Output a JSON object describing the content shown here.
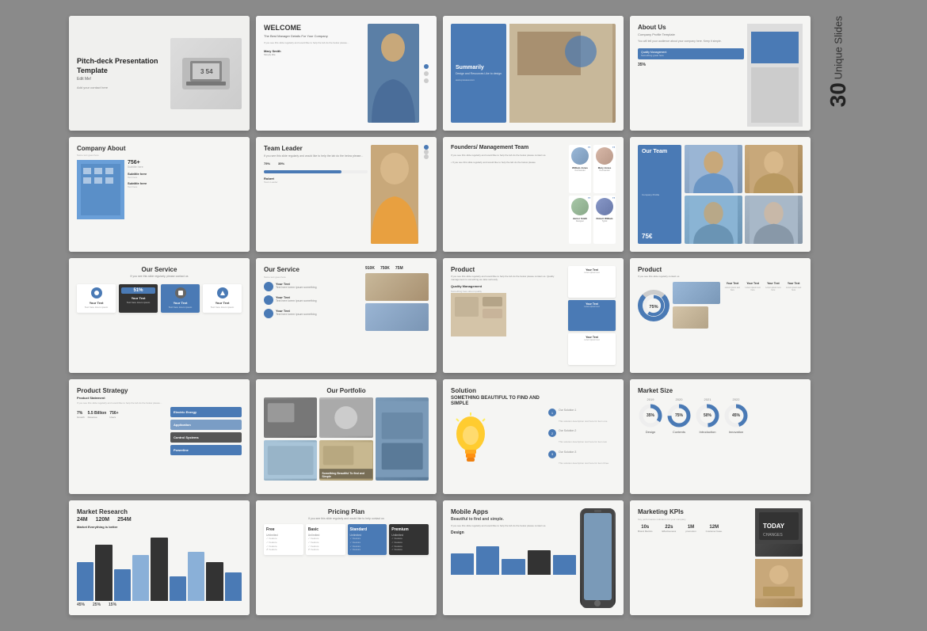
{
  "page": {
    "background_color": "#8a8a8a",
    "side_label": {
      "number": "30",
      "text": "Unique Slides"
    }
  },
  "slides": [
    {
      "id": 1,
      "title": "Pitch-deck Presentation Template",
      "subtitle": "Edit Me!",
      "meta": "Add your contact here"
    },
    {
      "id": 2,
      "title": "WELCOME",
      "subtitle": "The Best Manager Details For Your Company",
      "person_name": "Mary Smith",
      "person_role": "Simply title"
    },
    {
      "id": 3,
      "title": "Summarily",
      "subtitle": "Design and Resources Like to design",
      "url": "www.preview.com"
    },
    {
      "id": 4,
      "title": "About Us",
      "subtitle": "Company Profile Template",
      "section2_title": "Quality Management"
    },
    {
      "id": 5,
      "title": "Company About",
      "stat": "756+"
    },
    {
      "id": 6,
      "title": "Team Leader",
      "progress1": 75,
      "progress2": 35,
      "person_name": "Robert"
    },
    {
      "id": 7,
      "title": "Founders/ Management Team",
      "people": [
        {
          "name": "William Jones",
          "role": "Co-Founder"
        },
        {
          "name": "Mary Jones",
          "role": "Co-Founder"
        },
        {
          "name": "Junior Smith",
          "role": "Designer"
        },
        {
          "name": "Robert William",
          "role": "Typist"
        }
      ]
    },
    {
      "id": 8,
      "title": "Our Team",
      "stat": "75€"
    },
    {
      "id": 9,
      "title": "Our Service",
      "cards": [
        {
          "title": "Your Text",
          "percent": null
        },
        {
          "title": "Your Text",
          "percent": "51%"
        },
        {
          "title": "Your Text",
          "percent": null
        },
        {
          "title": "Your Text",
          "percent": null
        }
      ]
    },
    {
      "id": 10,
      "title": "Our Service",
      "items": [
        {
          "title": "Your Text"
        },
        {
          "title": "Your Text"
        },
        {
          "title": "Your Text"
        }
      ],
      "metrics": [
        "910K",
        "750K",
        "75M"
      ]
    },
    {
      "id": 11,
      "title": "Product",
      "quality": "Quality Management",
      "cards": [
        {
          "title": "Your Text"
        },
        {
          "title": "Your Text"
        },
        {
          "title": "Your Text"
        }
      ]
    },
    {
      "id": 12,
      "title": "Product",
      "cards": [
        {
          "title": "Your Text"
        },
        {
          "title": "Your Text"
        },
        {
          "title": "Your Text"
        },
        {
          "title": "Your Text"
        }
      ]
    },
    {
      "id": 13,
      "title": "Product Strategy",
      "statement": "Product Statement",
      "stats": [
        "7%",
        "5.5 Billion",
        "756+"
      ],
      "boxes": [
        {
          "title": "Electric Energy"
        },
        {
          "title": "Application"
        },
        {
          "title": "Control Systems"
        },
        {
          "title": "Powerline"
        }
      ]
    },
    {
      "id": 14,
      "title": "Our Portfolio",
      "label": "Something Beautiful To find and Simple"
    },
    {
      "id": 15,
      "title": "Solution",
      "big_text": "SOMETHING BEAUTIFUL TO FIND AND SIMPLE",
      "solutions": [
        "Our Solution 1",
        "Our Solution 2",
        "Our Solution 3"
      ]
    },
    {
      "id": 16,
      "title": "Market Size",
      "years": [
        "2019",
        "2020",
        "2021",
        "2022"
      ],
      "values": [
        "35%",
        "75%",
        "50%",
        "45%"
      ],
      "labels": [
        "Design",
        "Contents",
        "Introduction",
        "Innovation"
      ]
    },
    {
      "id": 17,
      "title": "Market Research",
      "subtitle": "Market Everything is better",
      "stats": [
        "24M",
        "120M",
        "254M"
      ],
      "percents": [
        "45%",
        "25%",
        "15%"
      ]
    },
    {
      "id": 18,
      "title": "Pricing Plan",
      "plans": [
        {
          "name": "Free",
          "price": "Unlimited"
        },
        {
          "name": "Basic",
          "price": "Unlimited"
        },
        {
          "name": "Standard",
          "price": "Unlimited"
        },
        {
          "name": "Premium",
          "price": "Unlimited"
        }
      ]
    },
    {
      "id": 19,
      "title": "Mobile Apps",
      "subtitle": "Beautiful to find and simple.",
      "section2": "Design"
    },
    {
      "id": 20,
      "title": "Marketing KPIs",
      "kpis": [
        {
          "value": "10s",
          "label": "Brand Metrics"
        },
        {
          "value": "22s",
          "label": "Effectiveness"
        },
        {
          "value": "1M",
          "label": "promotion"
        },
        {
          "value": "12M",
          "label": "Customer base."
        }
      ]
    }
  ]
}
